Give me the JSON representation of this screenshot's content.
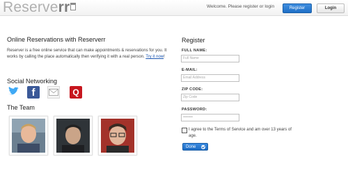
{
  "header": {
    "logo_text_light": "Reserve",
    "logo_text_accent": "rr",
    "welcome_text": "Welcome. Please register or login",
    "register_button": "Register",
    "login_button": "Login"
  },
  "intro": {
    "title": "Online Reservations with Reserverr",
    "body": "Reserver is a free online service that can make appointments & reservations for you. It works by calling the place automatically then verifying it with a real person.",
    "link": "Try it now",
    "link_suffix": "!"
  },
  "social": {
    "title": "Social Networking",
    "icons": [
      "twitter-icon",
      "facebook-icon",
      "mail-icon",
      "quora-icon"
    ],
    "facebook_glyph": "f",
    "quora_glyph": "Q"
  },
  "team": {
    "title": "The Team",
    "members": [
      "team-photo-1",
      "team-photo-2",
      "team-photo-3"
    ]
  },
  "register": {
    "title": "Register",
    "full_name_label": "FULL NAME:",
    "full_name_placeholder": "Full Name",
    "email_label": "E-MAIL:",
    "email_placeholder": "Email Address",
    "zip_label": "ZIP CODE:",
    "zip_placeholder": "Zip Code",
    "password_label": "PASSWORD:",
    "password_value": "••••••••",
    "terms": "I agree to the Terms of Service and am over 13 years of age.",
    "done_button": "Done"
  },
  "colors": {
    "accent_blue": "#1f6fc6",
    "facebook": "#3b5998",
    "quora": "#c7161e"
  }
}
